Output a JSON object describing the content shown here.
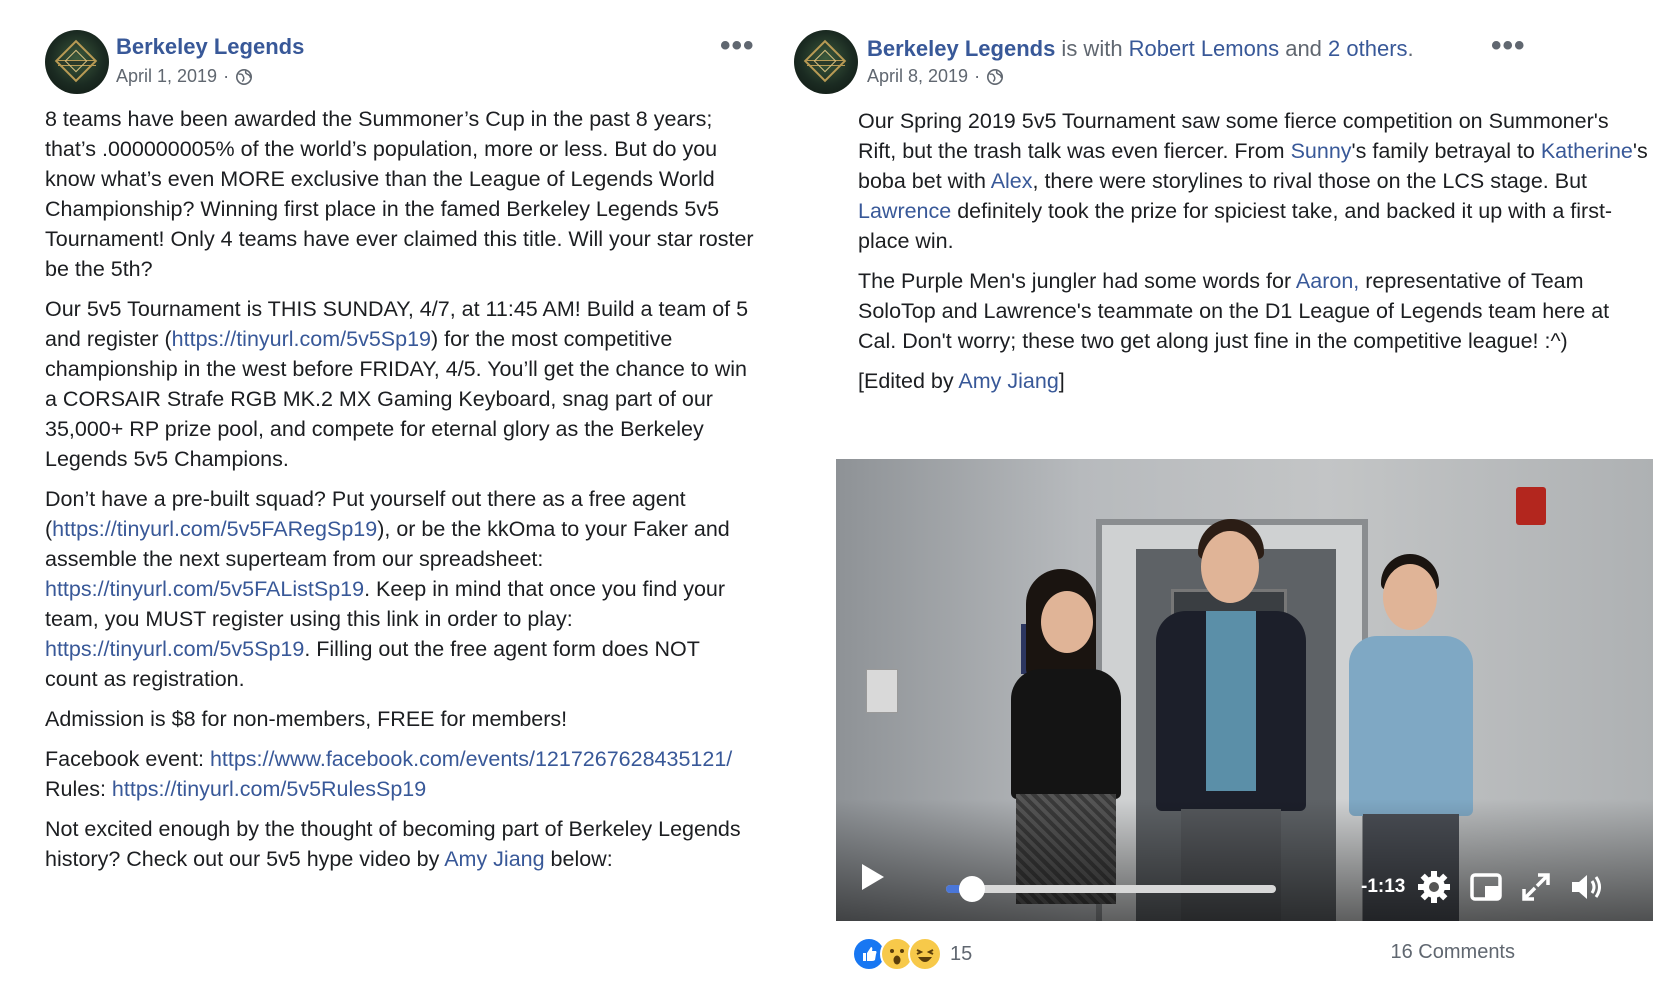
{
  "left_post": {
    "page_name": "Berkeley Legends",
    "date": "April 1, 2019",
    "separator": "·",
    "more": "•••",
    "paragraphs": [
      [
        {
          "t": "8 teams have been awarded the Summoner’s Cup in the past 8 years; that’s .000000005% of the world’s population, more or less. But do you know what’s even MORE exclusive than the League of Legends World Championship? Winning first place in the famed Berkeley Legends 5v5 Tournament! Only 4 teams have ever claimed this title. Will your star roster be the 5th?"
        }
      ],
      [
        {
          "t": "Our 5v5 Tournament is THIS SUNDAY, 4/7, at 11:45 AM! Build a team of 5 and register ("
        },
        {
          "t": "https://tinyurl.com/5v5Sp19",
          "link": true
        },
        {
          "t": ") for the most competitive championship in the west before FRIDAY, 4/5. You’ll get the chance to win a CORSAIR Strafe RGB MK.2 MX Gaming Keyboard, snag part of our 35,000+ RP prize pool, and compete for eternal glory as the Berkeley Legends 5v5 Champions."
        }
      ],
      [
        {
          "t": "Don’t have a pre-built squad? Put yourself out there as a free agent ("
        },
        {
          "t": "https://tinyurl.com/5v5FARegSp19",
          "link": true
        },
        {
          "t": "), or be the kkOma to your Faker and assemble the next superteam from our spreadsheet: "
        },
        {
          "t": "https://tinyurl.com/5v5FAListSp19",
          "link": true
        },
        {
          "t": ". Keep in mind that once you find your team, you MUST register using this link in order to play: "
        },
        {
          "t": "https://tinyurl.com/5v5Sp19",
          "link": true
        },
        {
          "t": ". Filling out the free agent form does NOT count as registration."
        }
      ],
      [
        {
          "t": "Admission is $8 for non-members, FREE for members!"
        }
      ],
      [
        {
          "t": "Facebook event: "
        },
        {
          "t": "https://www.facebook.com/events/1217267628435121/",
          "link": true
        },
        {
          "t": "\n"
        },
        {
          "t": "Rules: "
        },
        {
          "t": "https://tinyurl.com/5v5RulesSp19",
          "link": true
        }
      ],
      [
        {
          "t": "Not excited enough by the thought of becoming part of Berkeley Legends history? Check out our 5v5 hype video by "
        },
        {
          "t": "Amy Jiang",
          "link": true
        },
        {
          "t": " below:"
        }
      ]
    ]
  },
  "right_post": {
    "page_name": "Berkeley Legends",
    "with_text": " is with ",
    "with_person": "Robert Lemons",
    "and_text": " and ",
    "others": "2 others",
    "period": ".",
    "date": "April 8, 2019",
    "separator": "·",
    "more": "•••",
    "paragraphs": [
      [
        {
          "t": "Our Spring 2019 5v5 Tournament saw some fierce competition on Summoner's Rift, but the trash talk was even fiercer. From "
        },
        {
          "t": "Sunny",
          "link": true
        },
        {
          "t": "'s family betrayal to "
        },
        {
          "t": "Katherine",
          "link": true
        },
        {
          "t": "'s boba bet with "
        },
        {
          "t": "Alex",
          "link": true
        },
        {
          "t": ", there were storylines to rival those on the LCS stage. But "
        },
        {
          "t": "Lawrence",
          "link": true
        },
        {
          "t": " definitely took the prize for spiciest take, and backed it up with a first-place win."
        }
      ],
      [
        {
          "t": "The Purple Men's jungler had some words for "
        },
        {
          "t": "Aaron,",
          "link": true
        },
        {
          "t": " representative of Team SoloTop and Lawrence's teammate on the D1 League of Legends team here at Cal. Don't worry; these two get along just fine in the competitive league! :^)"
        }
      ],
      [
        {
          "t": "[Edited by "
        },
        {
          "t": "Amy Jiang",
          "link": true
        },
        {
          "t": "]"
        }
      ]
    ],
    "video": {
      "time_remaining": "-1:13",
      "progress": 0.08,
      "icons": [
        "play-icon",
        "settings-icon",
        "picture-in-picture-icon",
        "fullscreen-icon",
        "volume-icon"
      ]
    },
    "reactions": {
      "types": [
        "like",
        "wow",
        "haha"
      ],
      "count": "15",
      "comments": "16 Comments"
    }
  },
  "colors": {
    "link": "#385898",
    "meta": "#606770",
    "text": "#1c1e21"
  }
}
